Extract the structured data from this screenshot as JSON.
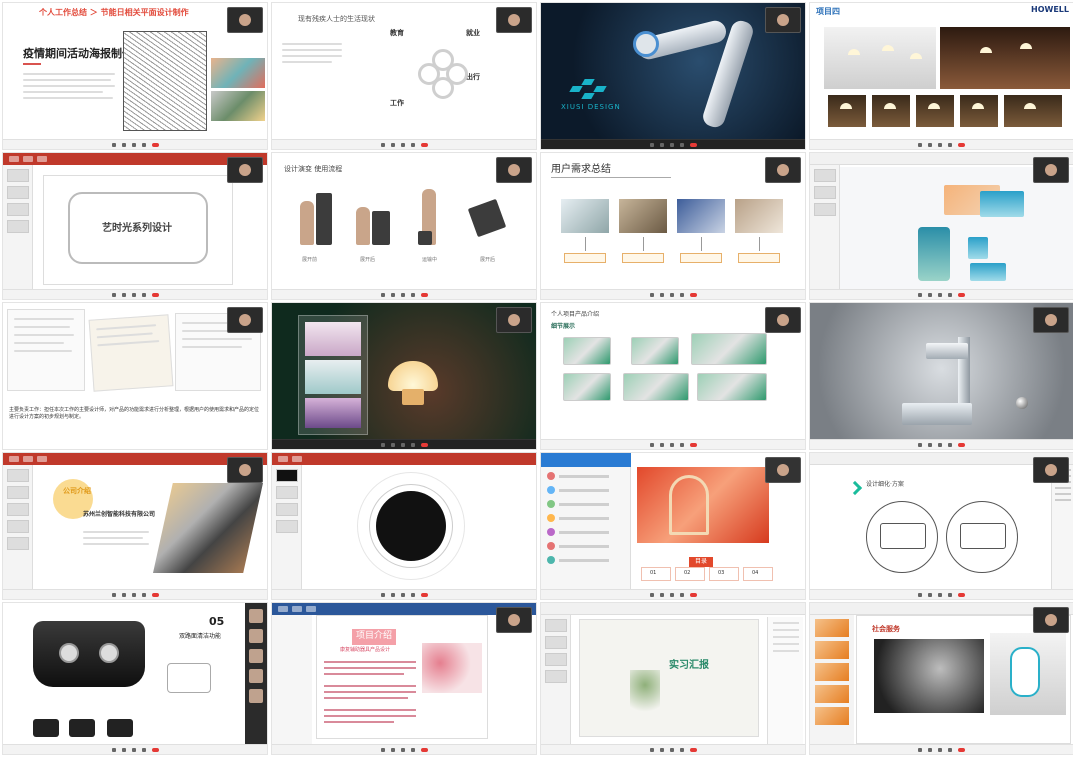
{
  "tiles": {
    "t1": {
      "crumb": "个人工作总结 ＞ 节能日相关平面设计制作",
      "title": "疫情期间活动海报制作"
    },
    "t2": {
      "title": "现有残疾人士的生活现状",
      "labels": [
        "教育",
        "就业",
        "工作",
        "出行"
      ]
    },
    "t3": {
      "logo": "XIUSI DESIGN"
    },
    "t4": {
      "title": "项目四",
      "brand": "HOWELL"
    },
    "t5": {
      "title": "艺时光系列设计"
    },
    "t6": {
      "title": "设计演变 使用流程",
      "captions": [
        "展开前",
        "展开后",
        "运输中",
        "展开后"
      ]
    },
    "t7": {
      "title": "用户需求总结"
    },
    "t9": {
      "text": "主要负责工作：担任本次工作的主要设计师，对产品的功能需求进行分析整理，根据用户的使用需求和产品的定位进行设计方案的初步规划与制定。"
    },
    "t11": {
      "title": "个人项目产品介绍",
      "subtitle": "细节展示"
    },
    "t13": {
      "badge": "公司介绍",
      "company": "苏州兰创智能科技有限公司"
    },
    "t15": {
      "cta": "目录",
      "stats": [
        "01",
        "02",
        "03",
        "04"
      ]
    },
    "t16": {
      "title": "设计细化·方案"
    },
    "t17": {
      "number": "05",
      "title": "双路面清洁功能"
    },
    "t18": {
      "title": "项目介绍",
      "subtitle": "康复辅助器具产品设计"
    },
    "t19": {
      "title": "实习汇报"
    },
    "t20": {
      "title": "社会服务"
    }
  },
  "colors": {
    "ribbon_ppt": "#c0392b",
    "ribbon_word": "#2b579a",
    "accent_teal": "#19b3c9",
    "end_call": "#e53935"
  },
  "icons": [
    "camera-feed-icon",
    "mic-icon",
    "video-icon",
    "share-screen-icon",
    "chat-icon",
    "end-call-icon"
  ]
}
